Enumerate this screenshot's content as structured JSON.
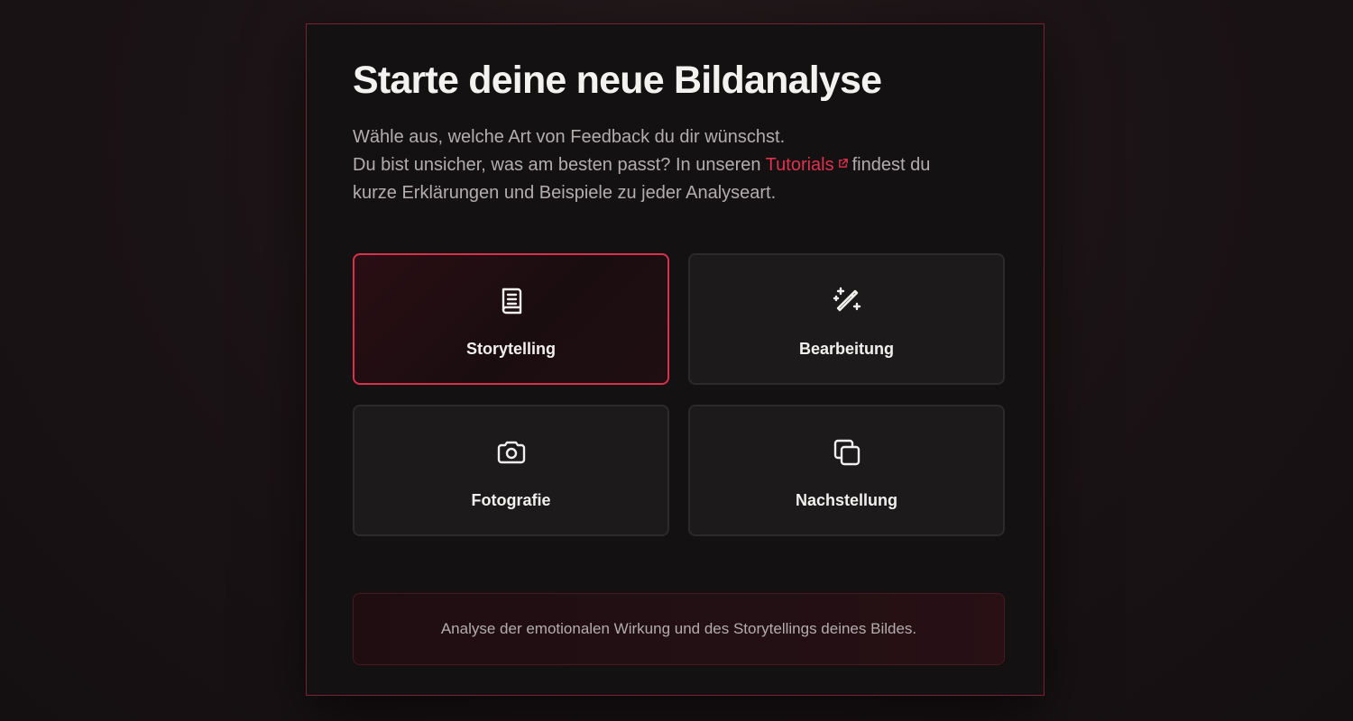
{
  "header": {
    "title": "Starte deine neue Bildanalyse",
    "desc_line1": "Wähle aus, welche Art von Feedback du dir wünschst.",
    "desc_line2_before": "Du bist unsicher, was am besten passt? In unseren ",
    "tutorials_link": "Tutorials",
    "desc_line2_after": "findest du",
    "desc_line3": "kurze Erklärungen und Beispiele zu jeder Analyseart."
  },
  "options": [
    {
      "label": "Storytelling",
      "icon": "book-icon",
      "selected": true
    },
    {
      "label": "Bearbeitung",
      "icon": "magic-wand-icon",
      "selected": false
    },
    {
      "label": "Fotografie",
      "icon": "camera-icon",
      "selected": false
    },
    {
      "label": "Nachstellung",
      "icon": "copy-icon",
      "selected": false
    }
  ],
  "info": {
    "text": "Analyse der emotionalen Wirkung und des Storytellings deines Bildes."
  },
  "colors": {
    "accent": "#d9304c",
    "background": "#1a1315",
    "card": "#1c1a1a"
  }
}
